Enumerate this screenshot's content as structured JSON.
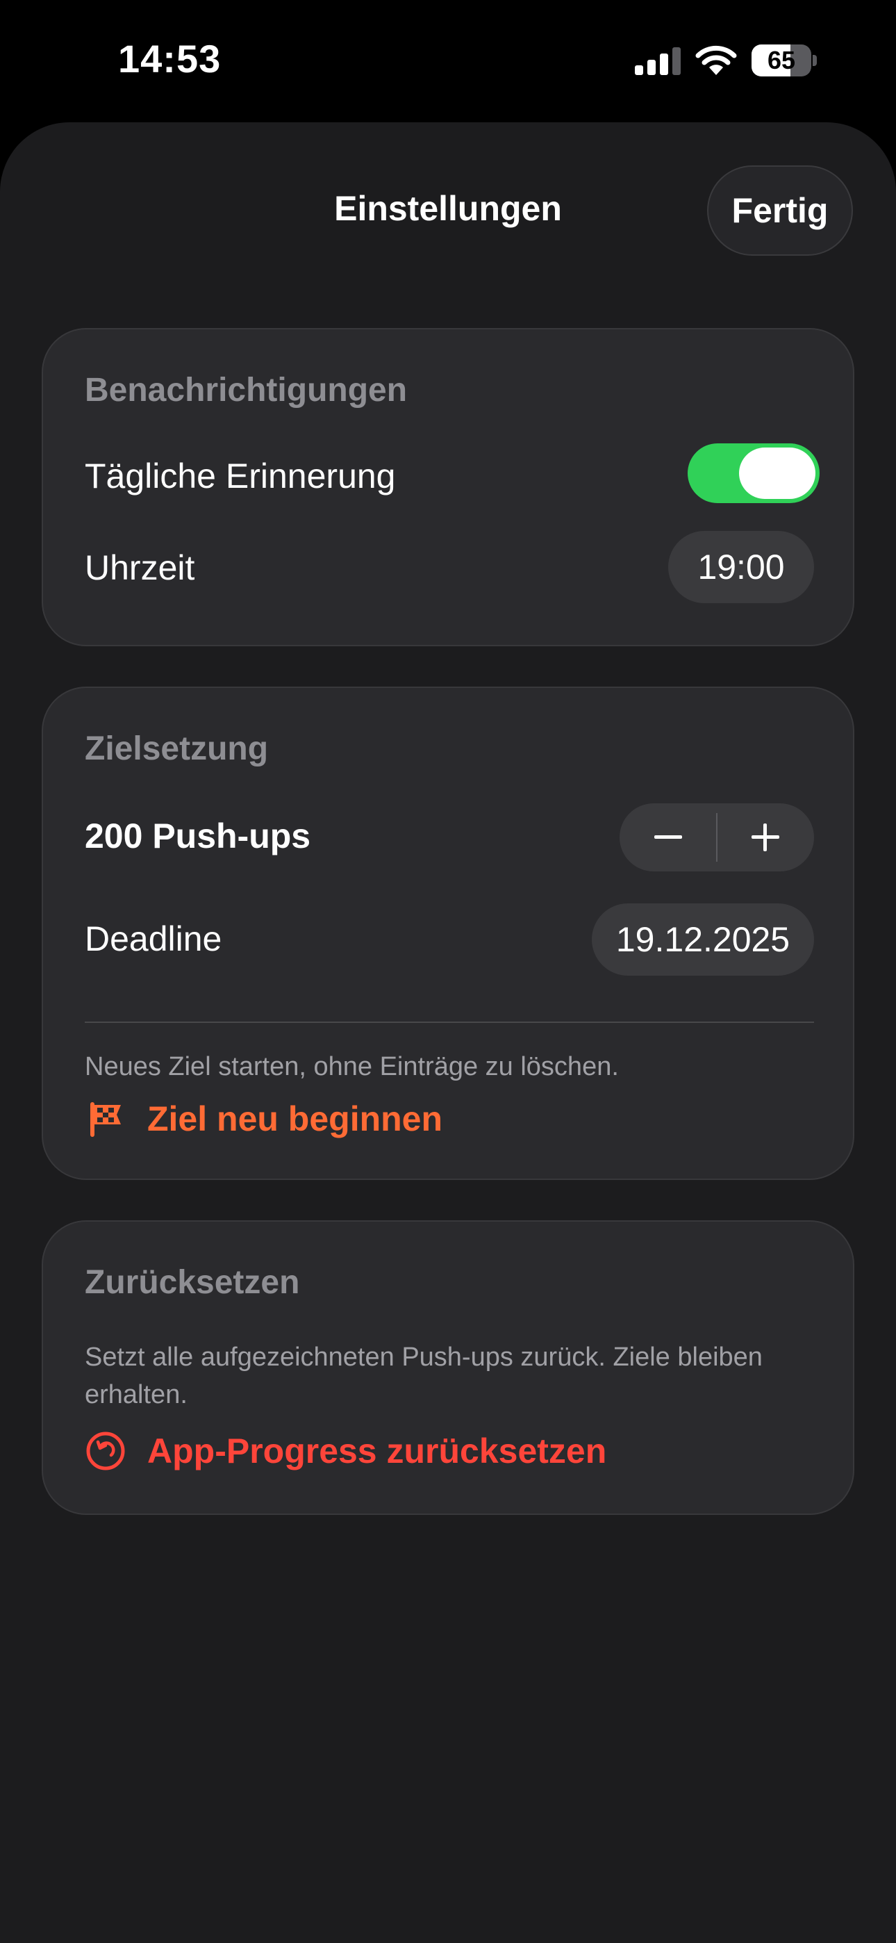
{
  "status_bar": {
    "time": "14:53",
    "battery": "65",
    "icons": [
      "cellular-signal-icon",
      "wifi-icon",
      "battery-icon"
    ]
  },
  "header": {
    "title": "Einstellungen",
    "done_label": "Fertig"
  },
  "notifications": {
    "title": "Benachrichtigungen",
    "daily_reminder_label": "Tägliche Erinnerung",
    "daily_reminder_on": true,
    "time_label": "Uhrzeit",
    "time_value": "19:00"
  },
  "goal": {
    "title": "Zielsetzung",
    "target_label": "200 Push-ups",
    "deadline_label": "Deadline",
    "deadline_value": "19.12.2025",
    "restart_note": "Neues Ziel starten, ohne Einträge zu löschen.",
    "restart_action": "Ziel neu beginnen",
    "restart_icon": "checkered-flag-icon"
  },
  "reset": {
    "title": "Zurücksetzen",
    "note": "Setzt alle aufgezeichneten Push-ups zurück. Ziele bleiben erhalten.",
    "action": "App-Progress zurücksetzen",
    "action_icon": "reset-arrow-icon"
  },
  "colors": {
    "accent_orange": "#ff6b35",
    "destructive_red": "#ff453a",
    "toggle_green": "#30d158"
  }
}
